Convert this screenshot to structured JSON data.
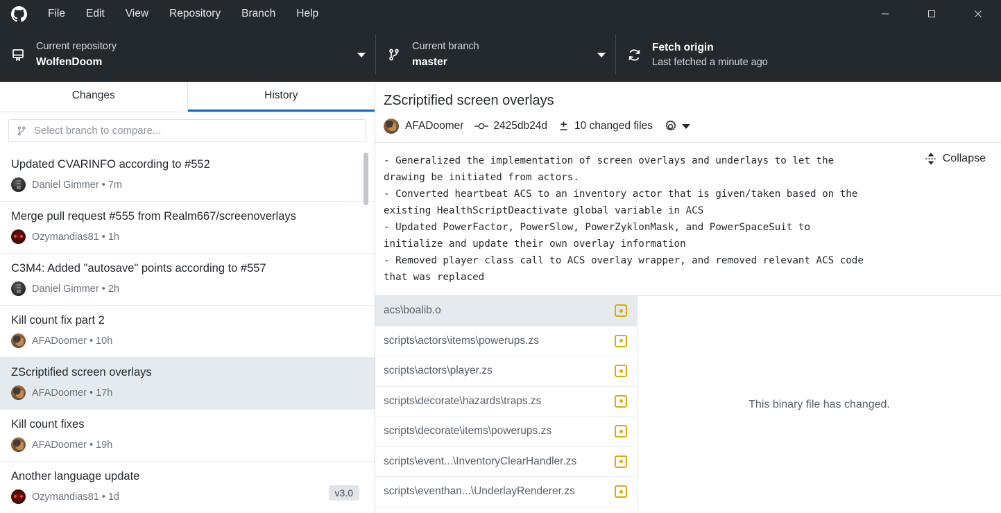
{
  "titlebar": {
    "logo_icon": "github-logo-icon",
    "menu": [
      {
        "label": "File"
      },
      {
        "label": "Edit"
      },
      {
        "label": "View"
      },
      {
        "label": "Repository"
      },
      {
        "label": "Branch"
      },
      {
        "label": "Help"
      }
    ],
    "window_controls": {
      "minimize": "minimize-icon",
      "maximize": "maximize-icon",
      "close": "close-icon"
    }
  },
  "toolbar": {
    "repository": {
      "icon": "repo-book-icon",
      "label": "Current repository",
      "value": "WolfenDoom"
    },
    "branch": {
      "icon": "branch-icon",
      "label": "Current branch",
      "value": "master"
    },
    "fetch": {
      "icon": "sync-refresh-icon",
      "title": "Fetch origin",
      "subtitle": "Last fetched a minute ago"
    }
  },
  "sidebar": {
    "tabs": [
      {
        "label": "Changes",
        "active": false
      },
      {
        "label": "History",
        "active": true
      }
    ],
    "filter": {
      "icon": "branch-icon",
      "placeholder": "Select branch to compare..."
    },
    "commits": [
      {
        "title": "Updated CVARINFO according to #552",
        "author": "Daniel Gimmer",
        "time": "7m",
        "avatar": "av-dg",
        "selected": false,
        "tag": ""
      },
      {
        "title": "Merge pull request #555 from Realm667/screenoverlays",
        "author": "Ozymandias81",
        "time": "1h",
        "avatar": "av-oz",
        "selected": false,
        "tag": ""
      },
      {
        "title": "C3M4: Added \"autosave\" points according to #557",
        "author": "Daniel Gimmer",
        "time": "2h",
        "avatar": "av-dg",
        "selected": false,
        "tag": ""
      },
      {
        "title": "Kill count fix part 2",
        "author": "AFADoomer",
        "time": "10h",
        "avatar": "av-af",
        "selected": false,
        "tag": ""
      },
      {
        "title": "ZScriptified screen overlays",
        "author": "AFADoomer",
        "time": "17h",
        "avatar": "av-af",
        "selected": true,
        "tag": ""
      },
      {
        "title": "Kill count fixes",
        "author": "AFADoomer",
        "time": "19h",
        "avatar": "av-af",
        "selected": false,
        "tag": ""
      },
      {
        "title": "Another language update",
        "author": "Ozymandias81",
        "time": "1d",
        "avatar": "av-oz",
        "selected": false,
        "tag": "v3.0"
      }
    ]
  },
  "commit_detail": {
    "title": "ZScriptified screen overlays",
    "author": "AFADoomer",
    "avatar": "av-af",
    "sha": "2425db24d",
    "sha_icon": "commit-dot-icon",
    "changed_files": "10 changed files",
    "changed_files_icon": "diff-plus-minus-icon",
    "options_icon": "gear-icon",
    "collapse": {
      "icon": "collapse-icon",
      "label": "Collapse"
    },
    "description": "- Generalized the implementation of screen overlays and underlays to let the\ndrawing be initiated from actors.\n- Converted heartbeat ACS to an inventory actor that is given/taken based on the\nexisting HealthScriptDeactivate global variable in ACS\n- Updated PowerFactor, PowerSlow, PowerZyklonMask, and PowerSpaceSuit to\ninitialize and update their own overlay information\n- Removed player class call to ACS overlay wrapper, and removed relevant ACS code\nthat was replaced",
    "files": [
      {
        "path": "acs\\boalib.o",
        "status": "modified",
        "selected": true
      },
      {
        "path": "scripts\\actors\\items\\powerups.zs",
        "status": "modified",
        "selected": false
      },
      {
        "path": "scripts\\actors\\player.zs",
        "status": "modified",
        "selected": false
      },
      {
        "path": "scripts\\decorate\\hazards\\traps.zs",
        "status": "modified",
        "selected": false
      },
      {
        "path": "scripts\\decorate\\items\\powerups.zs",
        "status": "modified",
        "selected": false
      },
      {
        "path": "scripts\\event...\\InventoryClearHandler.zs",
        "status": "modified",
        "selected": false
      },
      {
        "path": "scripts\\eventhan...\\UnderlayRenderer.zs",
        "status": "modified",
        "selected": false
      }
    ],
    "diff_message": "This binary file has changed."
  },
  "colors": {
    "chrome_dark": "#24292e",
    "accent_blue": "#0366d6",
    "status_modified": "#dbab09",
    "selection": "#e5eaef"
  }
}
